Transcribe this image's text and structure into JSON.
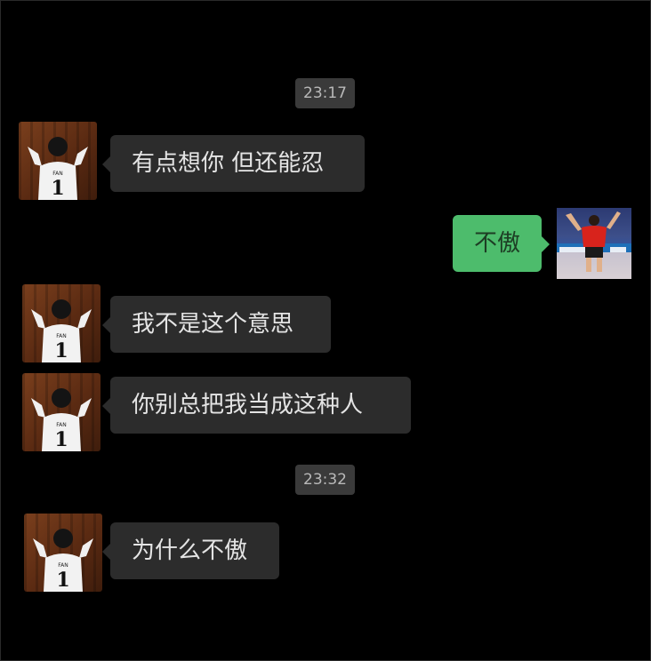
{
  "chat": {
    "timestamps": [
      "23:17",
      "23:32"
    ],
    "messages": [
      {
        "side": "left",
        "text": "有点想你 但还能忍"
      },
      {
        "side": "right",
        "text": "不傲"
      },
      {
        "side": "left",
        "text": "我不是这个意思"
      },
      {
        "side": "left",
        "text": "你别总把我当成这种人"
      },
      {
        "side": "left",
        "text": "为什么不傲"
      }
    ]
  },
  "avatars": {
    "contact": {
      "jersey_name": "FAN",
      "jersey_number": "1",
      "colors": {
        "background": "#6a3318",
        "shirt": "#f2f2f2"
      }
    },
    "me": {
      "colors": {
        "shirt": "#d8231c",
        "background": "#2f56a6"
      }
    }
  },
  "colors": {
    "background": "#000000",
    "incoming_bubble": "#2c2c2c",
    "outgoing_bubble": "#4dbc6c",
    "timestamp_bg": "#3a3a3a"
  }
}
